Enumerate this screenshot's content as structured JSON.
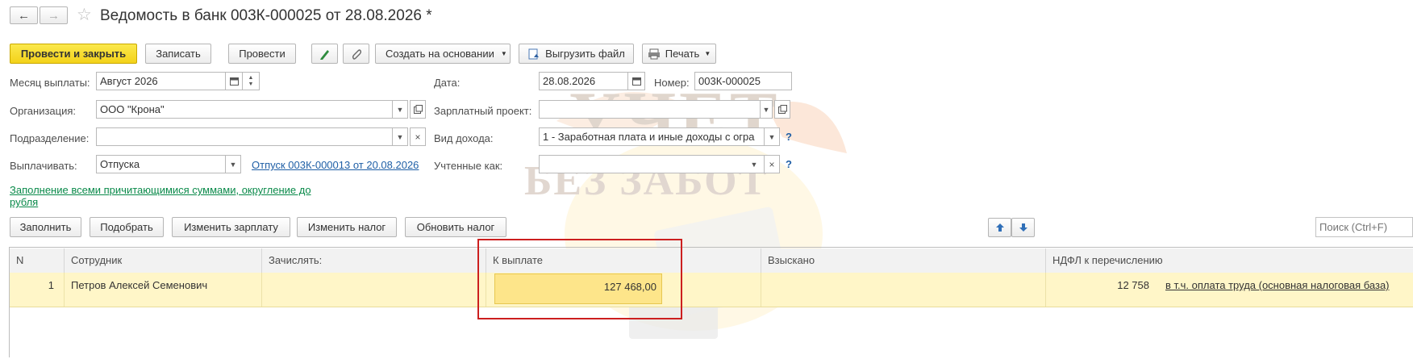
{
  "nav": {
    "back_glyph": "←",
    "forward_glyph": "→",
    "star_glyph": "☆"
  },
  "title": "Ведомость в банк 003К-000025 от 28.08.2026 *",
  "toolbar": {
    "post_close": "Провести и закрыть",
    "save": "Записать",
    "post": "Провести",
    "create_based": "Создать на основании",
    "upload_file": "Выгрузить файл",
    "print": "Печать"
  },
  "form": {
    "month_label": "Месяц выплаты:",
    "month_value": "Август 2026",
    "date_label": "Дата:",
    "date_value": "28.08.2026",
    "number_label": "Номер:",
    "number_value": "003К-000025",
    "org_label": "Организация:",
    "org_value": "ООО \"Крона\"",
    "salary_project_label": "Зарплатный проект:",
    "salary_project_value": "",
    "division_label": "Подразделение:",
    "division_value": "",
    "income_type_label": "Вид дохода:",
    "income_type_value": "1 - Заработная плата и иные доходы с огра",
    "pay_label": "Выплачивать:",
    "pay_value": "Отпуска",
    "vacation_link": "Отпуск 003К-000013 от 20.08.2026",
    "accounted_label": "Учтенные как:",
    "accounted_value": "",
    "help_glyph": "?",
    "fill_all_link_line1": "Заполнение всеми причитающимися суммами, округление до",
    "fill_all_link_line2": "рубля"
  },
  "table_toolbar": {
    "fill": "Заполнить",
    "pick": "Подобрать",
    "change_salary": "Изменить зарплату",
    "change_tax": "Изменить налог",
    "update_tax": "Обновить налог",
    "search_placeholder": "Поиск (Ctrl+F)"
  },
  "table": {
    "headers": [
      "N",
      "Сотрудник",
      "Зачислять:",
      "К выплате",
      "Взыскано",
      "НДФЛ к перечислению"
    ],
    "rows": [
      {
        "n": "1",
        "employee": "Петров Алексей Семенович",
        "credit_to": "",
        "to_pay": "127 468,00",
        "withheld": "",
        "ndfl": "12 758",
        "ndfl_link": "в т.ч. оплата труда (основная налоговая база)"
      }
    ]
  },
  "watermark": {
    "line1": "УЧЕТ",
    "line2": "БЕЗ ЗАБОТ"
  },
  "colors": {
    "primary_button": "#f3d21a",
    "highlight_box": "#cc1f1f",
    "row_highlight": "#fff6c8",
    "link": "#1f5fa6",
    "green_link": "#0a8a4a"
  }
}
